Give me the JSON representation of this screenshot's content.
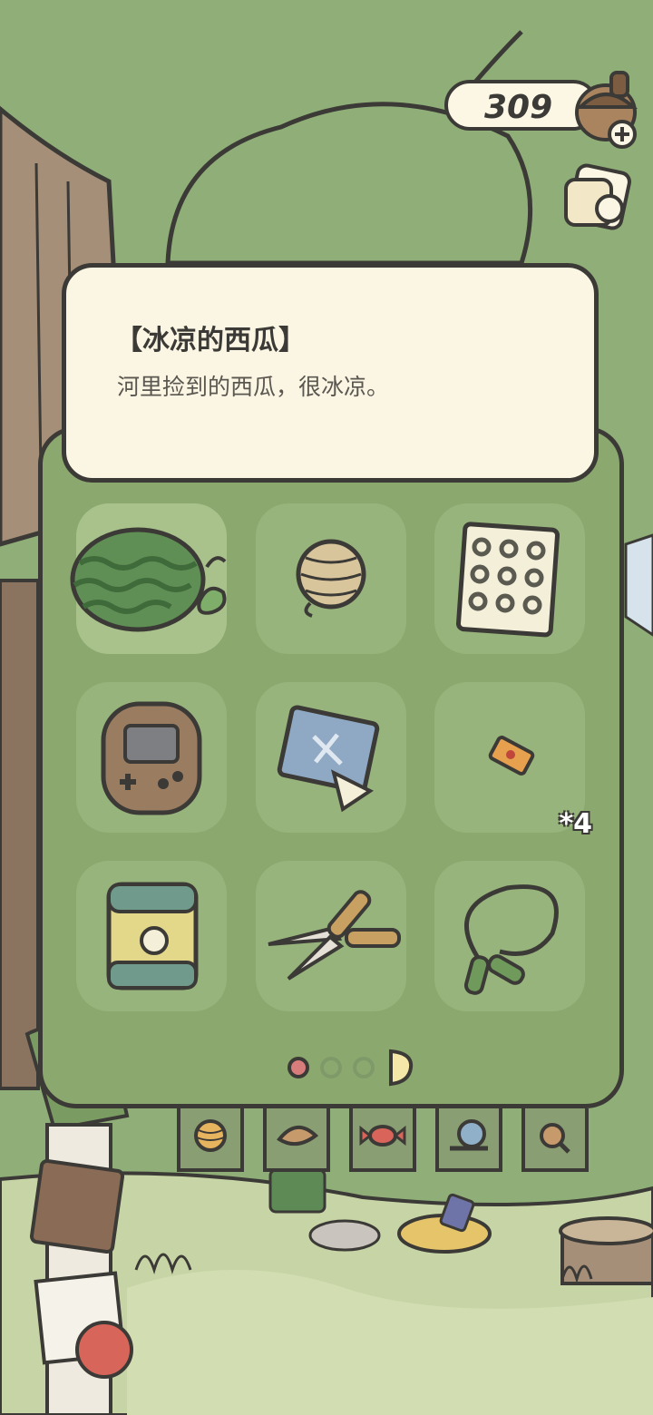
{
  "hud": {
    "clover_count": "309",
    "clover_icon": "acorn-plus-icon",
    "album_icon": "photo-album-icon"
  },
  "item_detail": {
    "name": "【冰凉的西瓜】",
    "description": "河里捡到的西瓜，很冰凉。"
  },
  "inventory": {
    "items": [
      {
        "icon": "watermelon-icon",
        "selected": true
      },
      {
        "icon": "yarn-ball-icon"
      },
      {
        "icon": "dotted-cloth-icon"
      },
      {
        "icon": "handheld-game-icon"
      },
      {
        "icon": "map-with-ticket-icon"
      },
      {
        "icon": "candy-ticket-icon",
        "quantity": "*4"
      },
      {
        "icon": "snack-bag-icon"
      },
      {
        "icon": "pruning-shears-icon"
      },
      {
        "icon": "jump-rope-icon"
      }
    ],
    "page": {
      "current": 1,
      "total": 3
    }
  },
  "category_tabs": [
    {
      "icon": "yarn-tab-icon"
    },
    {
      "icon": "leaf-tab-icon"
    },
    {
      "icon": "candy-tab-icon"
    },
    {
      "icon": "snail-tab-icon"
    },
    {
      "icon": "magnifier-tab-icon"
    }
  ],
  "colors": {
    "panel": "#8ba86f",
    "card": "#fbf6e3",
    "outline": "#3c3a36",
    "page_dot_active": "#d97c7c"
  }
}
